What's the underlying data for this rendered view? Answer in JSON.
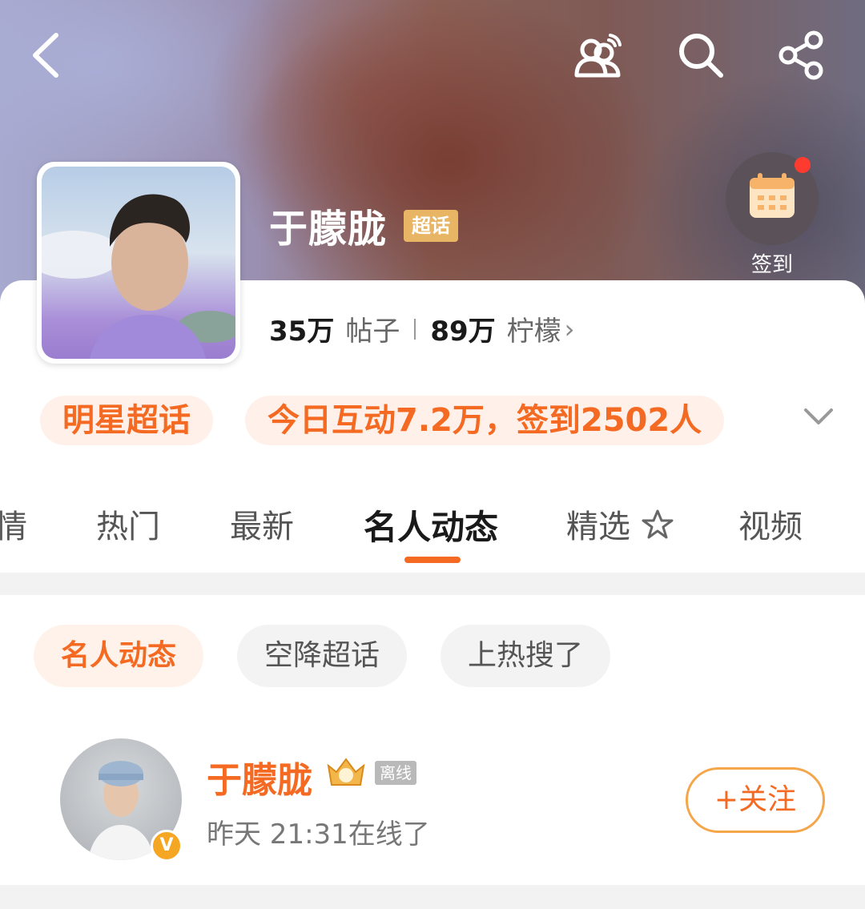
{
  "header": {
    "icons": [
      "back-icon",
      "group-chat-icon",
      "search-icon",
      "share-icon"
    ]
  },
  "profile": {
    "topic_name": "于朦胧",
    "badge": "超话",
    "checkin_label": "签到",
    "posts_count": "35万",
    "posts_label": "帖子",
    "fans_count": "89万",
    "fans_label": "柠檬"
  },
  "tags": {
    "category": "明星超话",
    "today_stats": "今日互动7.2万，签到2502人"
  },
  "tabs": [
    {
      "label": "情"
    },
    {
      "label": "热门"
    },
    {
      "label": "最新"
    },
    {
      "label": "名人动态",
      "active": true
    },
    {
      "label": "精选"
    },
    {
      "label": "视频"
    }
  ],
  "filters": [
    {
      "label": "名人动态",
      "active": true
    },
    {
      "label": "空降超话"
    },
    {
      "label": "上热搜了"
    }
  ],
  "celebrity": {
    "name": "于朦胧",
    "status_badge": "离线",
    "last_online": "昨天 21:31在线了",
    "follow_label": "+关注",
    "verified_mark": "V"
  },
  "colors": {
    "accent": "#f56a22",
    "badge_gold": "#e8b565",
    "pill_bg": "#fff1ea"
  }
}
